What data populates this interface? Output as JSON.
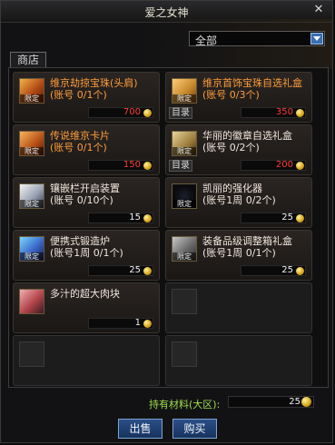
{
  "window": {
    "title": "爱之女神",
    "close": "✕"
  },
  "filter": {
    "selected": "全部"
  },
  "tabs": [
    {
      "label": "商店"
    }
  ],
  "items": [
    {
      "name": "维京劫掠宝珠(头肩)",
      "limit": "(账号 0/1个)",
      "price": "700",
      "price_color": "red",
      "tag": "限定",
      "has_catalog": false,
      "name_color": "orange",
      "icon": "orb-icon"
    },
    {
      "name": "维京首饰宝珠自选礼盒(账号 0/3个)",
      "limit": "",
      "price": "350",
      "price_color": "red",
      "tag": "限定",
      "has_catalog": true,
      "catalog": "目录",
      "name_color": "orange",
      "icon": "gift-box-icon"
    },
    {
      "name": "传说维京卡片",
      "limit": "(账号 0/1个)",
      "price": "150",
      "price_color": "red",
      "tag": "限定",
      "has_catalog": false,
      "name_color": "orange",
      "icon": "card-icon"
    },
    {
      "name": "华丽的徽章自选礼盒",
      "limit": "(账号 0/2个)",
      "price": "200",
      "price_color": "red",
      "tag": "限定",
      "has_catalog": true,
      "catalog": "目录",
      "name_color": "white",
      "icon": "badge-box-icon"
    },
    {
      "name": "镶嵌栏开启装置",
      "limit": "(账号 0/10个)",
      "price": "15",
      "price_color": "white",
      "tag": "限定",
      "has_catalog": false,
      "name_color": "white",
      "icon": "socket-opener-icon"
    },
    {
      "name": "凯丽的强化器",
      "limit": "(账号1周 0/2个)",
      "price": "25",
      "price_color": "white",
      "tag": "限定",
      "has_catalog": false,
      "name_color": "white",
      "icon": "enhancer-icon"
    },
    {
      "name": "便携式锻造炉",
      "limit": "(账号1周 0/1个)",
      "price": "25",
      "price_color": "white",
      "tag": "限定",
      "has_catalog": false,
      "name_color": "white",
      "icon": "forge-icon"
    },
    {
      "name": "装备品级调整箱礼盒",
      "limit": "(账号1周 0/1个)",
      "price": "25",
      "price_color": "white",
      "tag": "限定",
      "has_catalog": false,
      "name_color": "white",
      "icon": "grade-box-icon"
    },
    {
      "name": "多汁的超大肉块",
      "limit": "",
      "price": "1",
      "price_color": "white",
      "tag": "",
      "has_catalog": false,
      "name_color": "white",
      "icon": "meat-icon"
    }
  ],
  "footer": {
    "label": "持有材料(大区):",
    "value": "25"
  },
  "buttons": {
    "sell": "出售",
    "buy": "购买"
  }
}
